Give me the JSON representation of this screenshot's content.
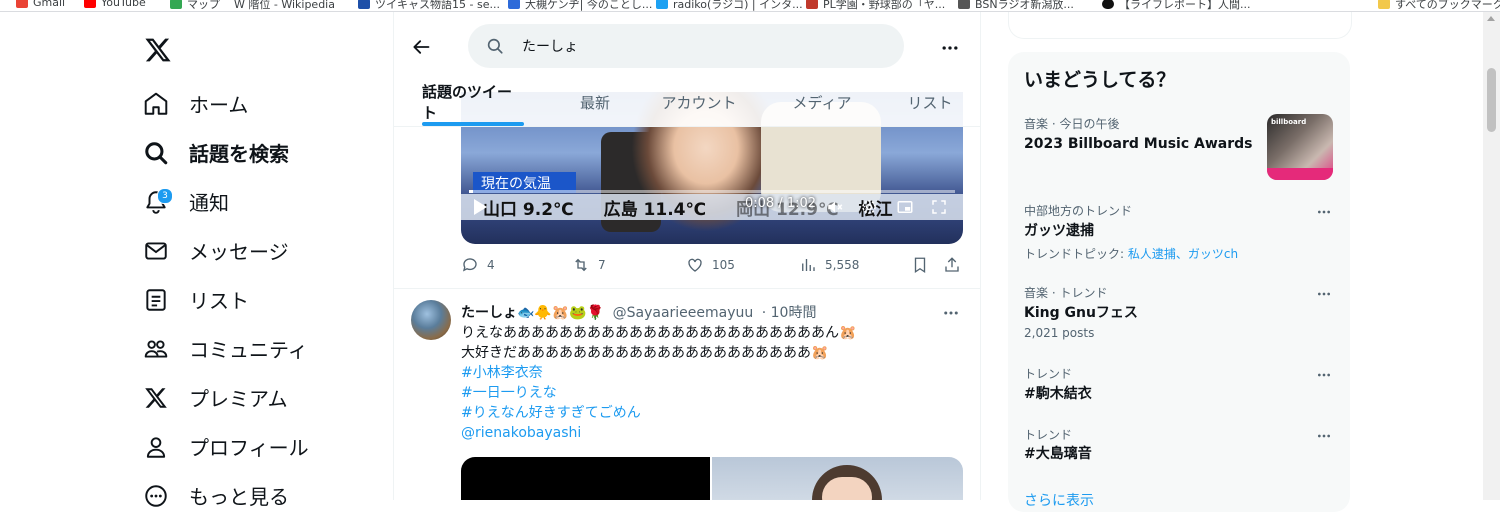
{
  "bookmarks": [
    {
      "label": "Gmail",
      "color": "#ea4335"
    },
    {
      "label": "YouTube",
      "color": "#ff0000"
    },
    {
      "label": "マップ",
      "color": "#34a853"
    },
    {
      "label": "W 階位 - Wikipedia",
      "color": "#777777"
    },
    {
      "label": "ツイキャス物語15 - se...",
      "color": "#1d4fa8"
    },
    {
      "label": "大槻ケンヂ| 今のことし...",
      "color": "#2d6ad9"
    },
    {
      "label": "radiko(ラジコ) | インタ...",
      "color": "#1da1f2"
    },
    {
      "label": "PL学園・野球部の「ヤ...",
      "color": "#c0392b"
    },
    {
      "label": "BSNラジオ新潟放...",
      "color": "#555555"
    },
    {
      "label": "【ライフレポート】人間...",
      "color": "#111111"
    },
    {
      "label": "すべてのブックマーク",
      "color": "#f2c84b"
    }
  ],
  "nav": {
    "items": [
      {
        "label": "ホーム",
        "icon": "home-icon"
      },
      {
        "label": "話題を検索",
        "icon": "search-icon"
      },
      {
        "label": "通知",
        "icon": "bell-icon",
        "badge": "3"
      },
      {
        "label": "メッセージ",
        "icon": "mail-icon"
      },
      {
        "label": "リスト",
        "icon": "list-icon"
      },
      {
        "label": "コミュニティ",
        "icon": "community-icon"
      },
      {
        "label": "プレミアム",
        "icon": "x-icon"
      },
      {
        "label": "プロフィール",
        "icon": "profile-icon"
      },
      {
        "label": "もっと見る",
        "icon": "more-circle-icon"
      }
    ]
  },
  "search": {
    "value": "たーしょ"
  },
  "tabs": [
    "話題のツイート",
    "最新",
    "アカウント",
    "メディア",
    "リスト"
  ],
  "video": {
    "caption_label": "現在の気温",
    "ticker": [
      "山口 9.2℃",
      "広島 11.4℃",
      "岡山 12.9℃",
      "松江"
    ],
    "time": "0:08 / 1:02",
    "progress": 0.008
  },
  "tweet1": {
    "replies": "4",
    "retweets": "7",
    "likes": "105",
    "views": "5,558"
  },
  "tweet2": {
    "name": "たーしょ🐟🐥🐹🐸🌹",
    "handle": "@Sayaarieeemayuu",
    "time": "· 10時間",
    "lines": [
      "りえなあああああああああああああああああああああああん🐹",
      "大好きだあああああああああああああああああああああ🐹"
    ],
    "hashtags": [
      "#小林李衣奈",
      "#一日一りえな",
      "#りえなん好きすぎてごめん"
    ],
    "mention": "@rienakobayashi"
  },
  "trends": {
    "title": "いまどうしてる？",
    "items": [
      {
        "category": "音楽 · 今日の午後",
        "name": "2023 Billboard Music Awards",
        "thumb_text": "billboard"
      },
      {
        "category": "中部地方のトレンド",
        "name": "ガッツ逮捕",
        "sub_prefix": "トレンドトピック: ",
        "sub_links": "私人逮捕、ガッツch"
      },
      {
        "category": "音楽 · トレンド",
        "name": "King Gnuフェス",
        "sub": "2,021 posts"
      },
      {
        "category": "トレンド",
        "name": "#駒木結衣"
      },
      {
        "category": "トレンド",
        "name": "#大島璃音"
      }
    ],
    "show_more": "さらに表示"
  },
  "colors": {
    "accent": "#1d9bf0",
    "text": "#0f1419",
    "muted": "#536471"
  }
}
